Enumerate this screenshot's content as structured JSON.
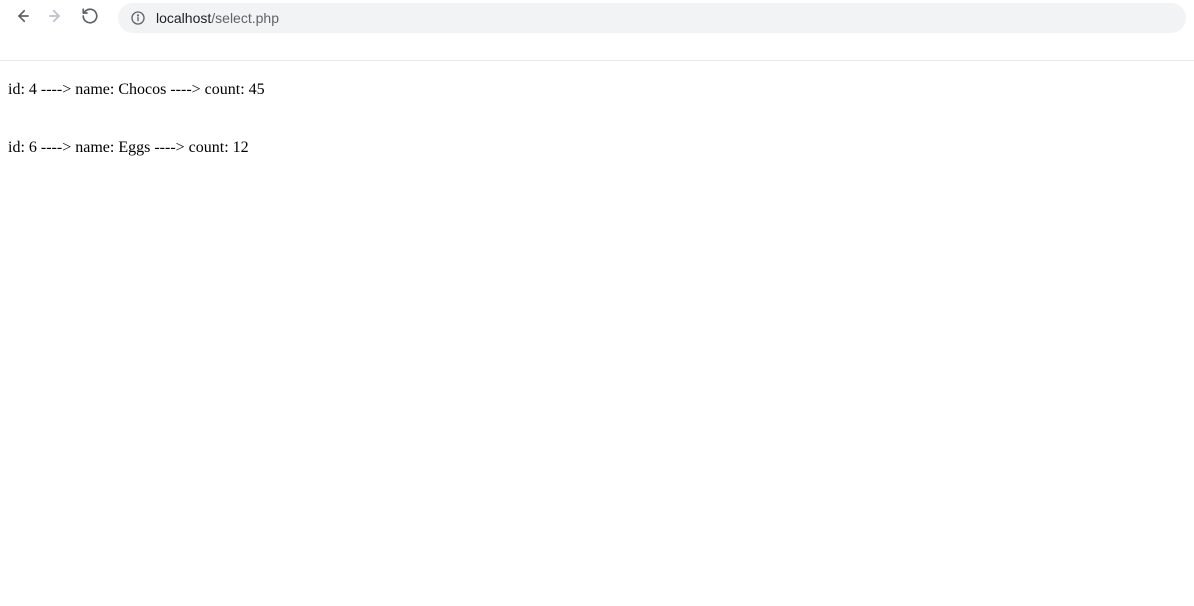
{
  "browser": {
    "url_host": "localhost",
    "url_path": "/select.php"
  },
  "records": [
    {
      "id": "4",
      "name": "Chocos",
      "count": "45",
      "sep": " ----> "
    },
    {
      "id": "6",
      "name": "Eggs",
      "count": "12",
      "sep": " ----> "
    }
  ],
  "labels": {
    "id": "id: ",
    "name": "name: ",
    "count": "count: "
  }
}
